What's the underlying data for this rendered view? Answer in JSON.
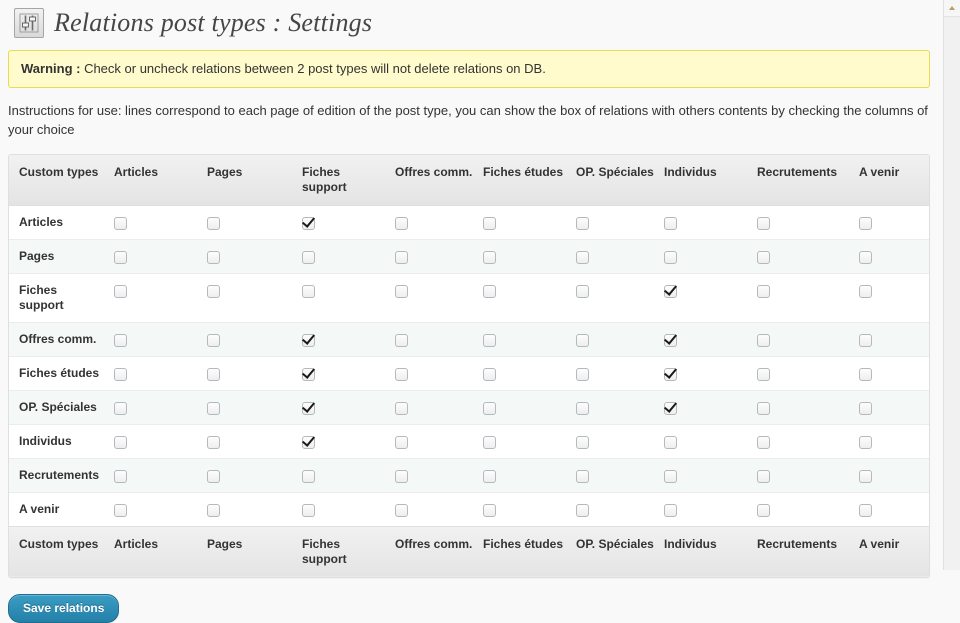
{
  "header": {
    "icon": "sliders-settings-icon",
    "title": "Relations post types : Settings"
  },
  "warning": {
    "label": "Warning :",
    "text": " Check or uncheck relations between 2 post types will not delete relations on DB."
  },
  "instructions": {
    "text": "Instructions for use: lines correspond to each page of edition of the post type, you can show the box of relations with others contents by checking the columns of your choice"
  },
  "table": {
    "columns": [
      "Custom types",
      "Articles",
      "Pages",
      "Fiches support",
      "Offres comm.",
      "Fiches études",
      "OP. Spéciales",
      "Individus",
      "Recrutements",
      "A venir"
    ],
    "rows": [
      {
        "label": "Articles",
        "checks": [
          false,
          false,
          true,
          false,
          false,
          false,
          false,
          false,
          false
        ]
      },
      {
        "label": "Pages",
        "checks": [
          false,
          false,
          false,
          false,
          false,
          false,
          false,
          false,
          false
        ]
      },
      {
        "label": "Fiches support",
        "checks": [
          false,
          false,
          false,
          false,
          false,
          false,
          true,
          false,
          false
        ]
      },
      {
        "label": "Offres comm.",
        "checks": [
          false,
          false,
          true,
          false,
          false,
          false,
          true,
          false,
          false
        ]
      },
      {
        "label": "Fiches études",
        "checks": [
          false,
          false,
          true,
          false,
          false,
          false,
          true,
          false,
          false
        ]
      },
      {
        "label": "OP. Spéciales",
        "checks": [
          false,
          false,
          true,
          false,
          false,
          false,
          true,
          false,
          false
        ]
      },
      {
        "label": "Individus",
        "checks": [
          false,
          false,
          true,
          false,
          false,
          false,
          false,
          false,
          false
        ]
      },
      {
        "label": "Recrutements",
        "checks": [
          false,
          false,
          false,
          false,
          false,
          false,
          false,
          false,
          false
        ]
      },
      {
        "label": "A venir",
        "checks": [
          false,
          false,
          false,
          false,
          false,
          false,
          false,
          false,
          false
        ]
      }
    ]
  },
  "actions": {
    "save_label": "Save relations"
  },
  "colors": {
    "accent": "#2480a8",
    "warning_bg": "#fffbcc",
    "warning_border": "#e6db55",
    "row_alt": "#f4f9f8",
    "header_bg": "#e9e9e9"
  },
  "scrollbar": {
    "up_arrow": "scroll-up-arrow-icon"
  }
}
